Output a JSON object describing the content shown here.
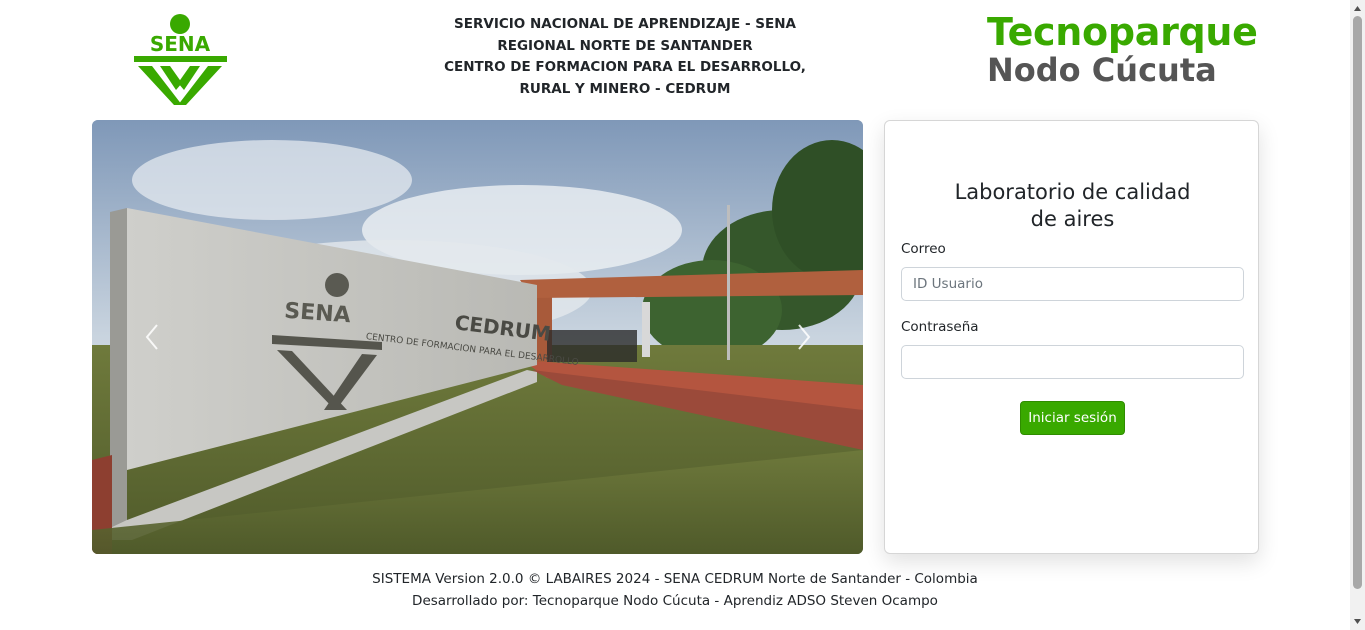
{
  "header": {
    "sena_logo_text": "SENA",
    "institution_lines": [
      "SERVICIO NACIONAL DE APRENDIZAJE - SENA",
      "REGIONAL NORTE DE SANTANDER",
      "CENTRO DE FORMACION PARA EL DESARROLLO,",
      "RURAL Y MINERO - CEDRUM"
    ],
    "brand_line1": "Tecnoparque",
    "brand_line2": "Nodo Cúcuta"
  },
  "carousel": {
    "prev_icon": "chevron-left-icon",
    "next_icon": "chevron-right-icon",
    "wall_sign_logo": "SENA",
    "wall_sign_name": "CEDRUM",
    "wall_sign_sub": "CENTRO DE FORMACION PARA EL DESARROLLO"
  },
  "login": {
    "title_line1": "Laboratorio de calidad",
    "title_line2": "de aires",
    "email_label": "Correo",
    "email_placeholder": "ID Usuario",
    "email_value": "",
    "password_label": "Contraseña",
    "password_value": "",
    "submit_label": "Iniciar sesión"
  },
  "footer": {
    "line1": "SISTEMA Version 2.0.0 © LABAIRES 2024 - SENA CEDRUM Norte de Santander - Colombia",
    "line2": "Desarrollado por: Tecnoparque Nodo Cúcuta - Aprendiz ADSO Steven Ocampo"
  },
  "colors": {
    "brand_green": "#39a900",
    "brand_gray": "#555555",
    "button_green": "#39a900"
  }
}
